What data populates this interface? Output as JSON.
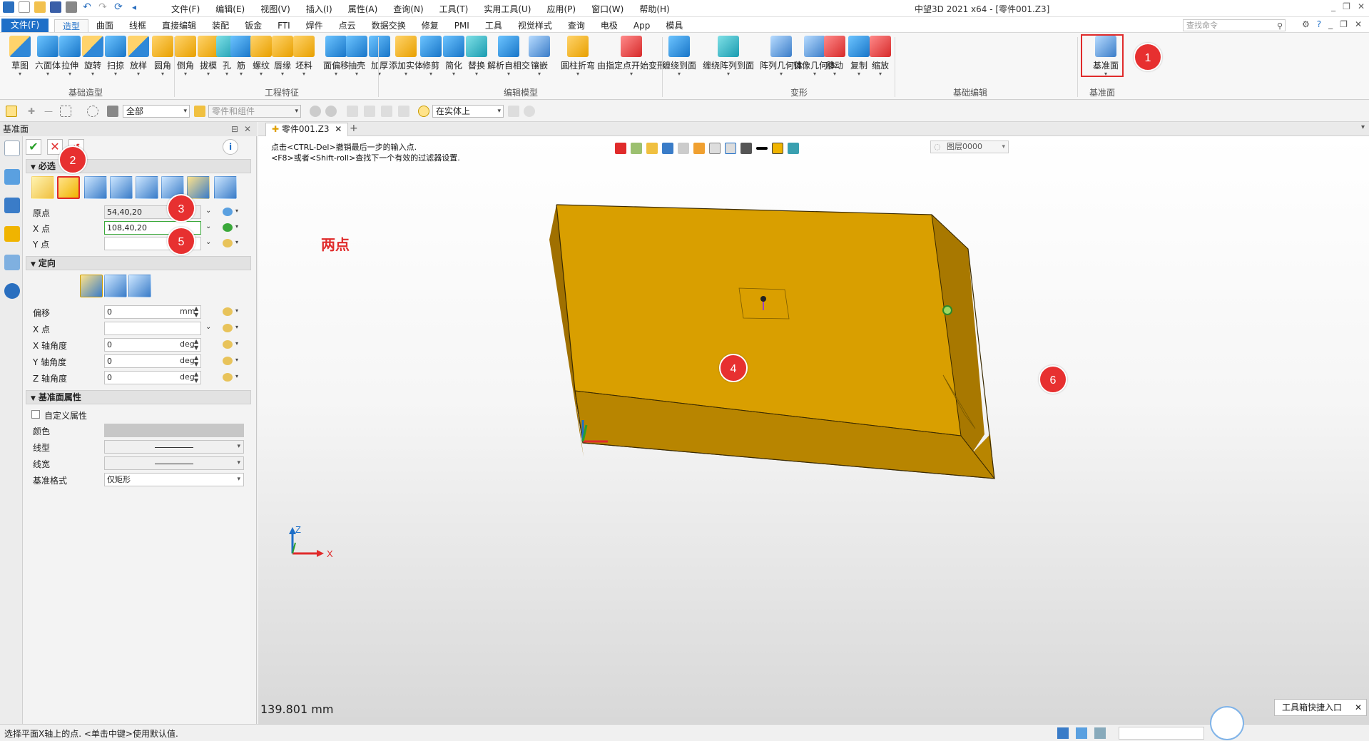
{
  "titlebar": {
    "menus": [
      "文件(F)",
      "编辑(E)",
      "视图(V)",
      "插入(I)",
      "属性(A)",
      "查询(N)",
      "工具(T)",
      "实用工具(U)",
      "应用(P)",
      "窗口(W)",
      "帮助(H)"
    ],
    "app_title": "中望3D 2021 x64 - [零件001.Z3]"
  },
  "ribbon_tabs": {
    "file": "文件(F)",
    "tabs": [
      "造型",
      "曲面",
      "线框",
      "直接编辑",
      "装配",
      "钣金",
      "FTI",
      "焊件",
      "点云",
      "数据交换",
      "修复",
      "PMI",
      "工具",
      "视觉样式",
      "查询",
      "电极",
      "App",
      "模具"
    ],
    "active": "造型",
    "search_placeholder": "查找命令"
  },
  "ribbon": {
    "buttons": [
      {
        "label": "草图",
        "icon": "sketch-icon"
      },
      {
        "label": "六面体",
        "icon": "box-icon"
      },
      {
        "label": "拉伸",
        "icon": "extrude-icon"
      },
      {
        "label": "旋转",
        "icon": "revolve-icon"
      },
      {
        "label": "扫掠",
        "icon": "sweep-icon"
      },
      {
        "label": "放样",
        "icon": "loft-icon"
      },
      {
        "label": "圆角",
        "icon": "fillet-icon"
      },
      {
        "label": "倒角",
        "icon": "chamfer-icon"
      },
      {
        "label": "拔模",
        "icon": "draft-icon"
      },
      {
        "label": "孔",
        "icon": "hole-icon"
      },
      {
        "label": "筋",
        "icon": "rib-icon"
      },
      {
        "label": "螺纹",
        "icon": "thread-icon"
      },
      {
        "label": "唇缘",
        "icon": "lip-icon"
      },
      {
        "label": "坯料",
        "icon": "stock-icon"
      },
      {
        "label": "面偏移",
        "icon": "face-offset-icon"
      },
      {
        "label": "抽壳",
        "icon": "shell-icon"
      },
      {
        "label": "加厚",
        "icon": "thicken-icon"
      },
      {
        "label": "添加实体",
        "icon": "add-solid-icon"
      },
      {
        "label": "修剪",
        "icon": "trim-icon"
      },
      {
        "label": "简化",
        "icon": "simplify-icon"
      },
      {
        "label": "替换",
        "icon": "replace-icon"
      },
      {
        "label": "解析自相交",
        "icon": "resolve-intersect-icon"
      },
      {
        "label": "镶嵌",
        "icon": "inlay-icon"
      },
      {
        "label": "圆柱折弯",
        "icon": "cylinder-bend-icon"
      },
      {
        "label": "由指定点开始变形",
        "icon": "deform-point-icon"
      },
      {
        "label": "缠绕到面",
        "icon": "wrap-face-icon"
      },
      {
        "label": "缠绕阵列到面",
        "icon": "wrap-pattern-icon"
      },
      {
        "label": "阵列几何体",
        "icon": "pattern-icon"
      },
      {
        "label": "镜像几何体",
        "icon": "mirror-icon"
      },
      {
        "label": "移动",
        "icon": "move-icon"
      },
      {
        "label": "复制",
        "icon": "copy-icon"
      },
      {
        "label": "缩放",
        "icon": "scale-icon"
      },
      {
        "label": "基准面",
        "icon": "datum-plane-icon"
      }
    ],
    "groups": [
      "基础造型",
      "工程特征",
      "编辑模型",
      "变形",
      "基础编辑",
      "基准面"
    ]
  },
  "filterbar": {
    "filter_value": "全部",
    "scope_value": "零件和组件",
    "snap_value": "在实体上"
  },
  "panel": {
    "title": "基准面",
    "required_section": "必选",
    "origin_label": "原点",
    "origin_value": "54,40,20",
    "xpoint_label": "X 点",
    "xpoint_value": "108,40,20",
    "ypoint_label": "Y 点",
    "ypoint_value": "",
    "orient_section": "定向",
    "offset_label": "偏移",
    "offset_value": "0",
    "offset_unit": "mm",
    "xpoint2_label": "X 点",
    "xangle_label": "X 轴角度",
    "xangle_value": "0",
    "yangle_label": "Y 轴角度",
    "yangle_value": "0",
    "zangle_label": "Z 轴角度",
    "zangle_value": "0",
    "angle_unit": "deg",
    "props_section": "基准面属性",
    "custom_props": "自定义属性",
    "color_label": "颜色",
    "linetype_label": "线型",
    "linewidth_label": "线宽",
    "datum_format_label": "基准格式",
    "datum_format_value": "仅矩形"
  },
  "doc_tab": "零件001.Z3",
  "viewport": {
    "prompt_line1": "点击<CTRL-Del>撤销最后一步的输入点.",
    "prompt_line2": "<F8>或者<Shift-roll>查找下一个有效的过滤器设置.",
    "layer": "图层0000",
    "annotation": "两点",
    "measure": "139.801 mm",
    "axis_x": "X",
    "axis_z": "Z",
    "box_top_color": "#d99f00",
    "box_front_color": "#b88500",
    "box_side_color": "#a87800"
  },
  "markers": [
    "1",
    "2",
    "3",
    "4",
    "5",
    "6"
  ],
  "statusbar": {
    "message": "选择平面X轴上的点. <单击中键>使用默认值.",
    "toolbox_popup": "工具箱快捷入口"
  },
  "colors": {
    "accent": "#1e6fc8",
    "marker": "#e73030",
    "highlight_border": "#e02b2b"
  }
}
